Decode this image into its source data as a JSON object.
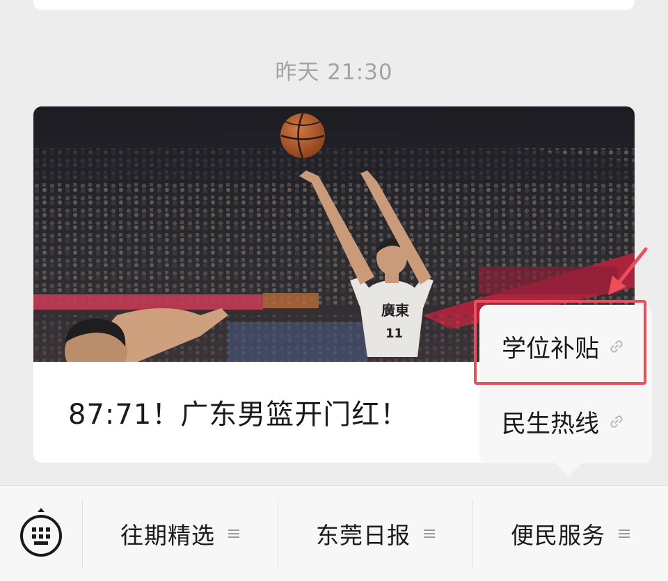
{
  "timestamp": "昨天 21:30",
  "article": {
    "title": "87:71！广东男篮开门红！",
    "cover_icon": "basketball-photo",
    "jersey_text": "廣東",
    "jersey_number": "11"
  },
  "submenu": {
    "items": [
      {
        "label": "学位补贴",
        "icon": "link-icon",
        "highlighted": true
      },
      {
        "label": "民生热线",
        "icon": "link-icon",
        "highlighted": false
      }
    ],
    "highlight_color": "#ec4f5c"
  },
  "menu_bar": {
    "keyboard_icon": "keyboard-icon",
    "tabs": [
      {
        "label": "往期精选",
        "icon": "menu-lines-icon"
      },
      {
        "label": "东莞日报",
        "icon": "menu-lines-icon"
      },
      {
        "label": "便民服务",
        "icon": "menu-lines-icon"
      }
    ]
  }
}
